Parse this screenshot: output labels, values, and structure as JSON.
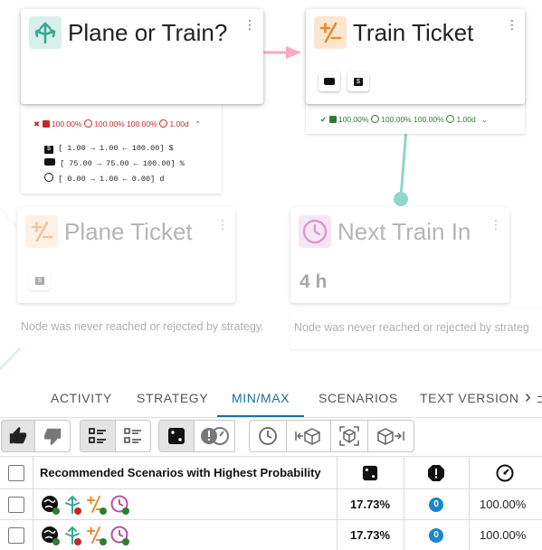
{
  "nodes": {
    "plane_or_train": {
      "title": "Plane or Train?",
      "stats": {
        "summary": [
          "100.00%",
          "100.00%",
          "100.00%",
          "1.00d"
        ],
        "rows": [
          {
            "icon": "dollar-icon",
            "text": "[      1.00 →    1.00 ← 100.00]  $"
          },
          {
            "icon": "couch-icon",
            "text": "[ 75.00 → 75.00 ← 100.00]  %"
          },
          {
            "icon": "clock-icon",
            "text": "[      0.00 →    1.00 ←    0.00]  d"
          }
        ]
      }
    },
    "train_ticket": {
      "title": "Train Ticket",
      "stats_summary": [
        "100.00%",
        "100.00%",
        "100.00%",
        "1.00d"
      ]
    },
    "plane_ticket": {
      "title": "Plane Ticket",
      "note": "Node was never reached or rejected by strategy."
    },
    "next_train_in": {
      "title": "Next Train In",
      "value": "4 h",
      "note": "Node was never reached or rejected by strateg"
    }
  },
  "tabs": [
    "ACTIVITY",
    "STRATEGY",
    "MIN/MAX",
    "SCENARIOS",
    "TEXT VERSION"
  ],
  "active_tab": "MIN/MAX",
  "tab_more": "›",
  "table": {
    "header": "Recommended Scenarios with Highest Probability",
    "rows": [
      {
        "probability": "17.73%",
        "risk_count": "0",
        "gauge": "100.00%"
      },
      {
        "probability": "17.73%",
        "risk_count": "0",
        "gauge": "100.00%"
      }
    ]
  },
  "colors": {
    "accent": "#1d6e9c",
    "teal": "#4db8a8",
    "orange": "#e8892f",
    "purple": "#b054a7",
    "edge_pink": "#f48fb1",
    "red": "#c62828",
    "green": "#2e7d32"
  }
}
